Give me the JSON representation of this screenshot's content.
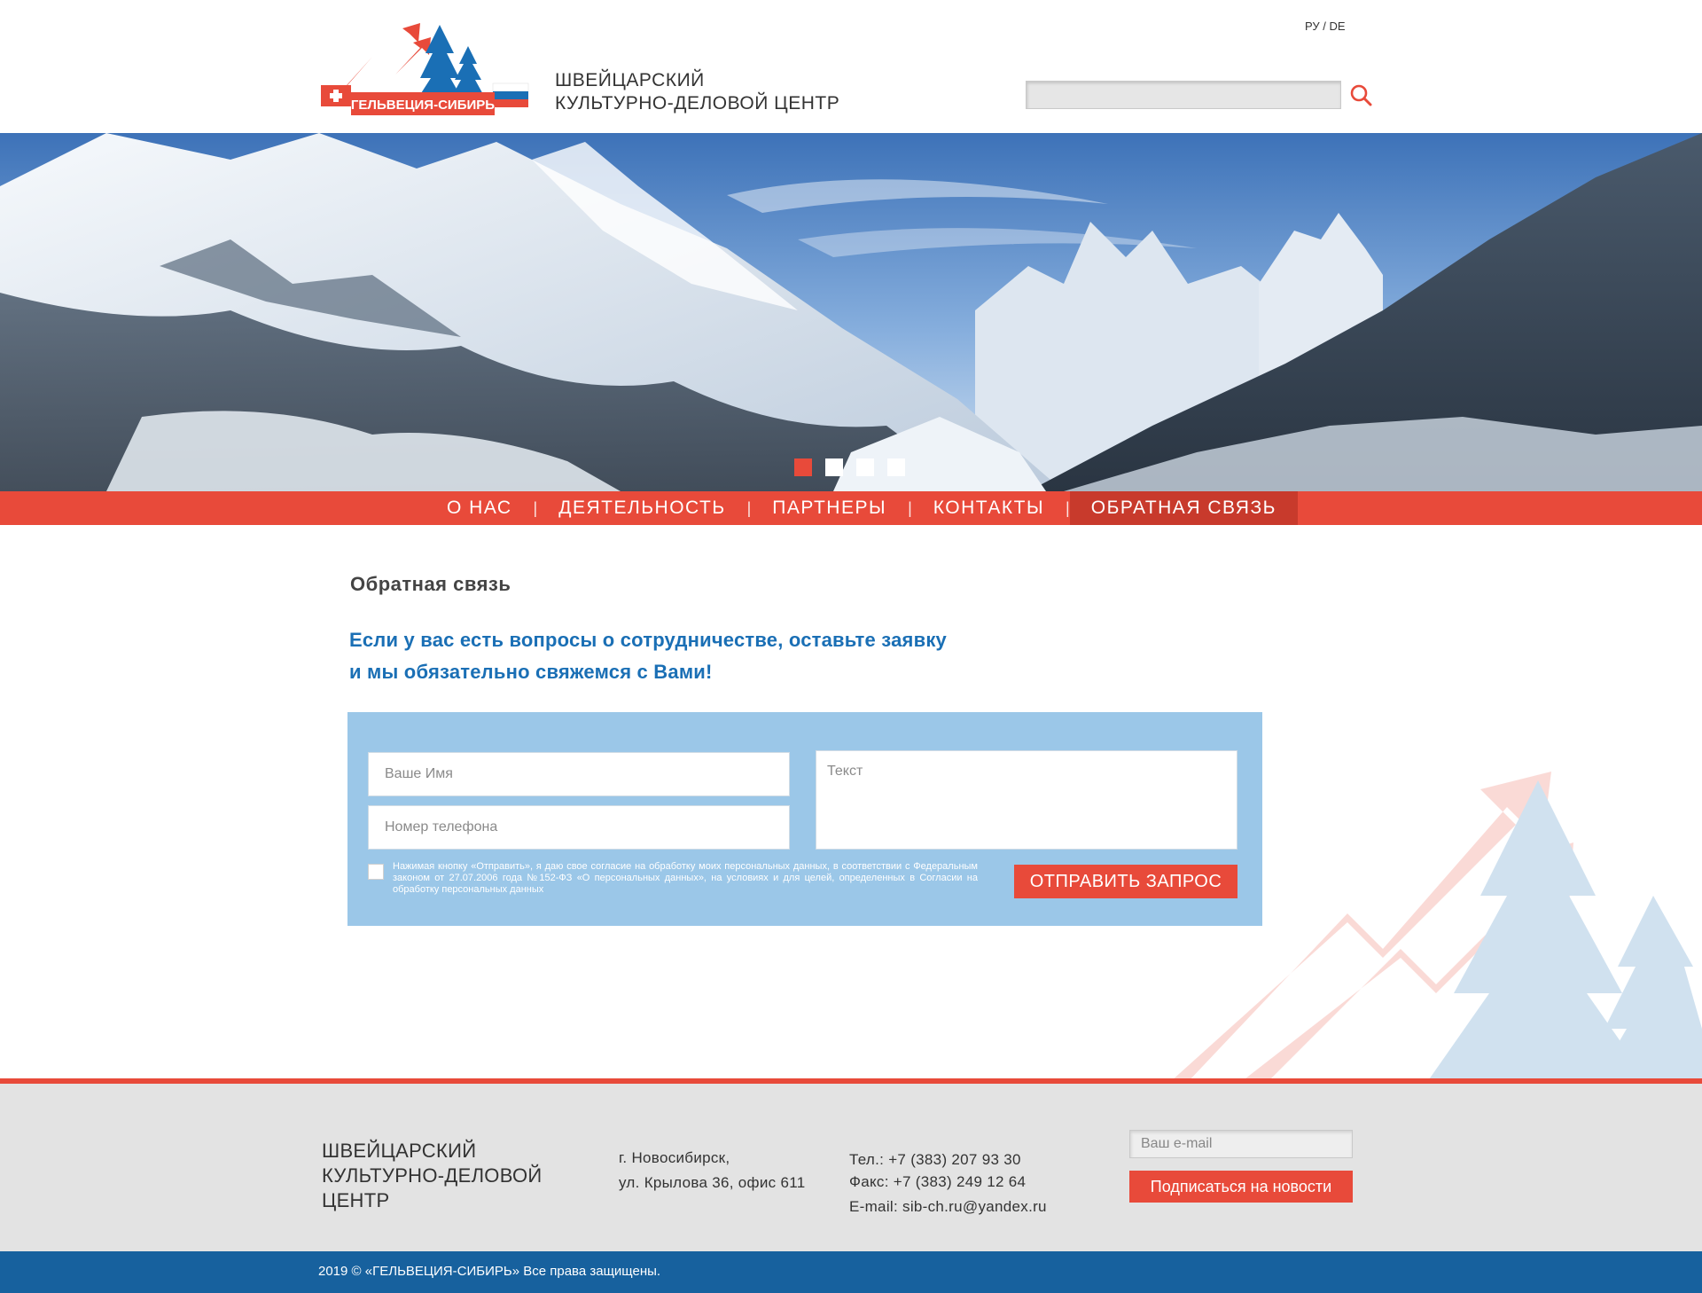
{
  "header": {
    "lang_ru": "РУ",
    "lang_sep": " / ",
    "lang_de": "DE",
    "logo_text": "ГЕЛЬВЕЦИЯ-СИБИРЬ",
    "tagline_line1": "ШВЕЙЦАРСКИЙ",
    "tagline_line2": "КУЛЬТУРНО-ДЕЛОВОЙ ЦЕНТР",
    "search_value": ""
  },
  "slider": {
    "slides": 4,
    "active_index": 0
  },
  "nav": {
    "items": [
      {
        "label": "О НАС"
      },
      {
        "label": "ДЕЯТЕЛЬНОСТЬ"
      },
      {
        "label": "ПАРТНЕРЫ"
      },
      {
        "label": "КОНТАКТЫ"
      },
      {
        "label": "ОБРАТНАЯ СВЯЗЬ"
      }
    ],
    "separator": "|",
    "active_index": 4
  },
  "content": {
    "title": "Обратная связь",
    "intro_line1": "Если у вас есть вопросы о сотрудничестве, оставьте заявку",
    "intro_line2": "и мы обязательно свяжемся с Вами!"
  },
  "form": {
    "name_placeholder": "Ваше Имя",
    "phone_placeholder": "Номер телефона",
    "text_placeholder": "Текст",
    "consent_text": "Нажимая кнопку «Отправить», я даю свое согласие на обработку моих персональных данных, в соответствии с Федеральным законом от 27.07.2006 года №152-ФЗ «О персональных данных», на условиях и для целей, определенных в Согласии на обработку персональных данных",
    "submit_label": "ОТПРАВИТЬ ЗАПРОС"
  },
  "footer": {
    "name_line1": "ШВЕЙЦАРСКИЙ",
    "name_line2": "КУЛЬТУРНО-ДЕЛОВОЙ",
    "name_line3": "ЦЕНТР",
    "address_line1": "г. Новосибирск,",
    "address_line2": "ул. Крылова 36, офис 611",
    "phone": "Тел.: +7 (383) 207 93 30",
    "fax": "Факс: +7 (383) 249 12 64",
    "email": "E-mail: sib-ch.ru@yandex.ru",
    "email_placeholder": "Ваш e-mail",
    "subscribe_label": "Подписаться на новости",
    "copyright": "2019 © «ГЕЛЬВЕЦИЯ-СИБИРЬ» Все права защищены."
  },
  "colors": {
    "accent_red": "#e84a3a",
    "active_nav": "#c83a2c",
    "brand_blue": "#1a6fb5",
    "form_bg": "#9bc7e8",
    "footer_bg": "#e3e3e3",
    "copyright_bg": "#17619e"
  },
  "icons": [
    "search-icon",
    "logo-icon",
    "watermark-logo-icon"
  ]
}
